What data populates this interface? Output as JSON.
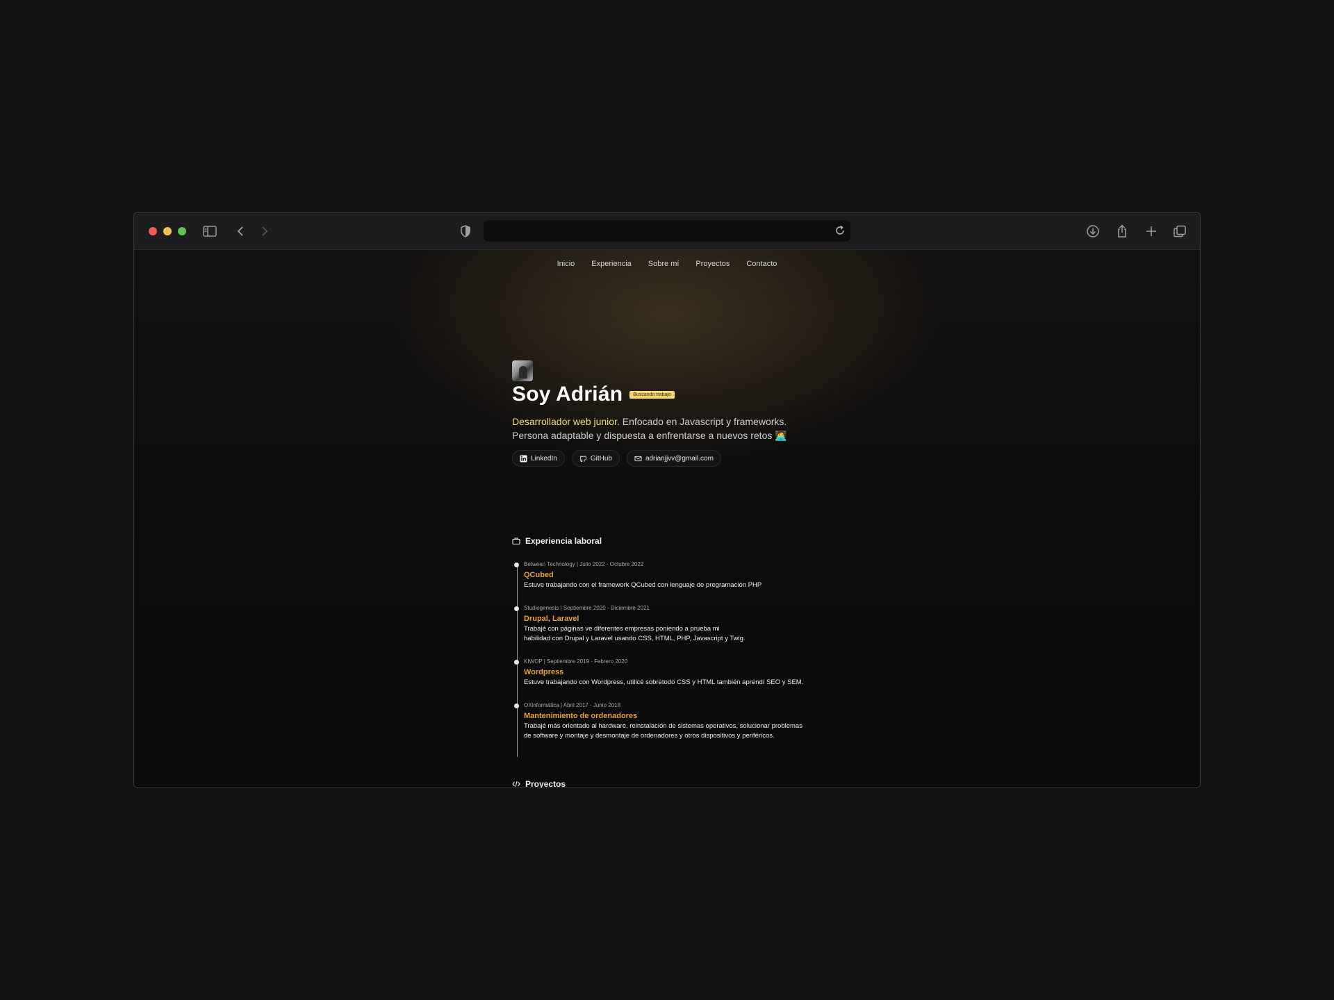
{
  "nav": {
    "items": [
      "Inicio",
      "Experiencia",
      "Sobre mí",
      "Proyectos",
      "Contacto"
    ]
  },
  "hero": {
    "name": "Soy Adrián",
    "badge": "Buscando trabajo",
    "highlight": "Desarrollador web junior.",
    "desc_rest": " Enfocado en Javascript y frameworks.",
    "desc_line2": "Persona adaptable y dispuesta a enfrentarse a nuevos retos 🧑‍💻",
    "links": {
      "linkedin": "LinkedIn",
      "github": "GitHub",
      "email": "adrianjjvv@gmail.com"
    }
  },
  "experience": {
    "title": "Experiencia laboral",
    "jobs": [
      {
        "meta": "Between Technology | Julio 2022 - Octubre 2022",
        "role": "QCubed",
        "text": "Estuve trabajando con el framework QCubed con lenguaje de pregramación PHP"
      },
      {
        "meta": "Studiogenesis | Septiembre 2020 - Diciembre 2021",
        "role": "Drupal, Laravel",
        "text": "Trabajé con páginas ve diferentes empresas poniendo a prueba mi\nhabilidad con Drupal y Laravel usando CSS, HTML, PHP, Javascript y Twig."
      },
      {
        "meta": "KIWOP | Septiembre 2019 - Febrero 2020",
        "role": "Wordpress",
        "text": "Estuve trabajando con Wordpress, utilicé sobretodo CSS y HTML también aprendí SEO y SEM."
      },
      {
        "meta": "OXinformática | Abril 2017 - Junio 2018",
        "role": "Mantenimiento de ordenadores",
        "text": "Trabajé más orientado al hardware, reinstalación de sistemas operativos, solucionar problemas\nde software y montaje y desmontaje de ordenadores y otros dispositivos y periféricos."
      }
    ]
  },
  "projects": {
    "title": "Proyectos"
  },
  "icons": {
    "sidebar": "sidebar-icon",
    "back": "chevron-left-icon",
    "forward": "chevron-right-icon",
    "shield": "shield-icon",
    "reload": "reload-icon",
    "download": "download-icon",
    "share": "share-icon",
    "new_tab": "plus-icon",
    "tabs": "tabs-overview-icon"
  },
  "colors": {
    "accent_orange": "#e9a03a",
    "highlight_yellow": "#f4de7a",
    "badge_bg": "#f2d675"
  }
}
